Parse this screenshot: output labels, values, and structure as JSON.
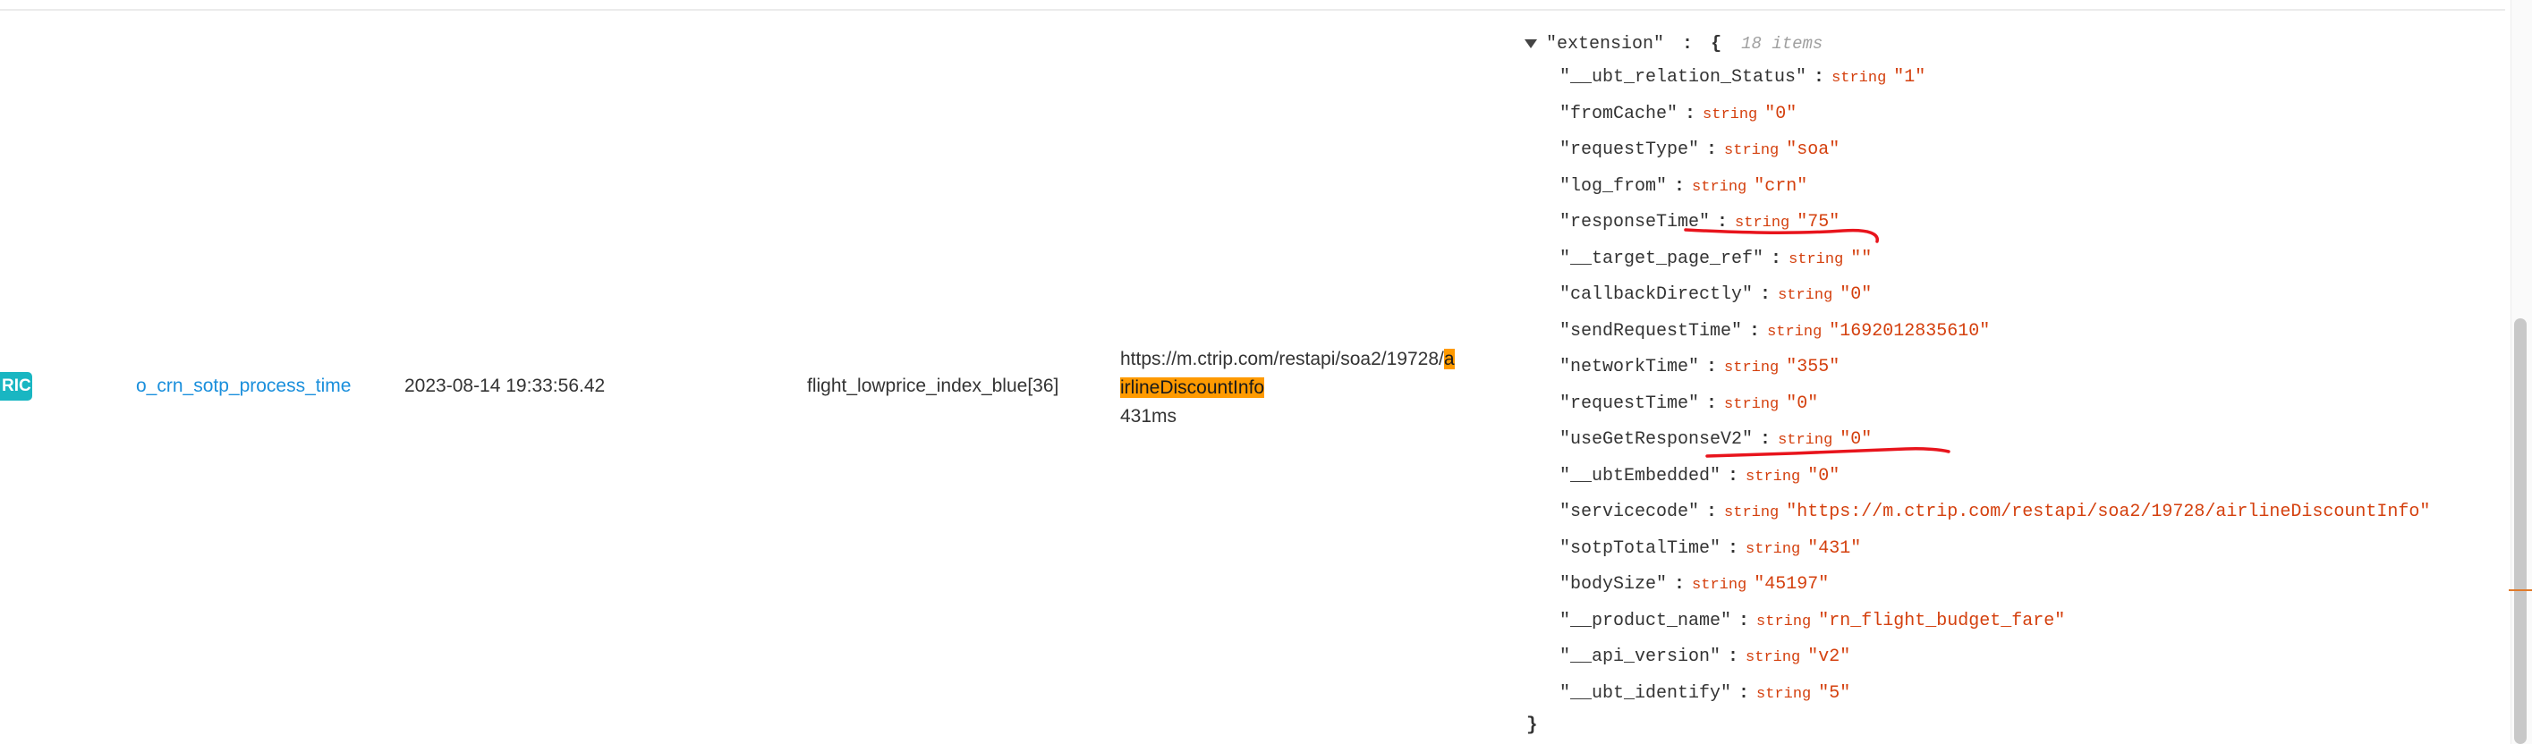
{
  "row": {
    "tag": "RIC",
    "event": "o_crn_sotp_process_time",
    "timestamp": "2023-08-14 19:33:56.42",
    "page": "flight_lowprice_index_blue[36]",
    "url_prefix": "https://m.ctrip.com/restapi/soa2/19728/",
    "url_highlight_a": "a",
    "url_highlight_b": "irlineDiscountInfo",
    "duration": "431ms"
  },
  "json_viewer": {
    "root_key": "\"extension\"",
    "open_brace": "{",
    "close_brace": "}",
    "colon": ":",
    "item_count": "18 items",
    "type_label": "string",
    "entries": [
      {
        "key": "\"__ubt_relation_Status\"",
        "value": "\"1\""
      },
      {
        "key": "\"fromCache\"",
        "value": "\"0\""
      },
      {
        "key": "\"requestType\"",
        "value": "\"soa\""
      },
      {
        "key": "\"log_from\"",
        "value": "\"crn\""
      },
      {
        "key": "\"responseTime\"",
        "value": "\"75\""
      },
      {
        "key": "\"__target_page_ref\"",
        "value": "\"\""
      },
      {
        "key": "\"callbackDirectly\"",
        "value": "\"0\""
      },
      {
        "key": "\"sendRequestTime\"",
        "value": "\"1692012835610\""
      },
      {
        "key": "\"networkTime\"",
        "value": "\"355\""
      },
      {
        "key": "\"requestTime\"",
        "value": "\"0\""
      },
      {
        "key": "\"useGetResponseV2\"",
        "value": "\"0\""
      },
      {
        "key": "\"__ubtEmbedded\"",
        "value": "\"0\""
      },
      {
        "key": "\"servicecode\"",
        "value": "\"https://m.ctrip.com/restapi/soa2/19728/airlineDiscountInfo\""
      },
      {
        "key": "\"sotpTotalTime\"",
        "value": "\"431\""
      },
      {
        "key": "\"bodySize\"",
        "value": "\"45197\""
      },
      {
        "key": "\"__product_name\"",
        "value": "\"rn_flight_budget_fare\""
      },
      {
        "key": "\"__api_version\"",
        "value": "\"v2\""
      },
      {
        "key": "\"__ubt_identify\"",
        "value": "\"5\""
      }
    ]
  },
  "colors": {
    "tag_bg": "#19b6c2",
    "link": "#1a8fdc",
    "highlight": "#ff9a00",
    "json_value": "#d4400e",
    "annotation": "#e8141c"
  }
}
